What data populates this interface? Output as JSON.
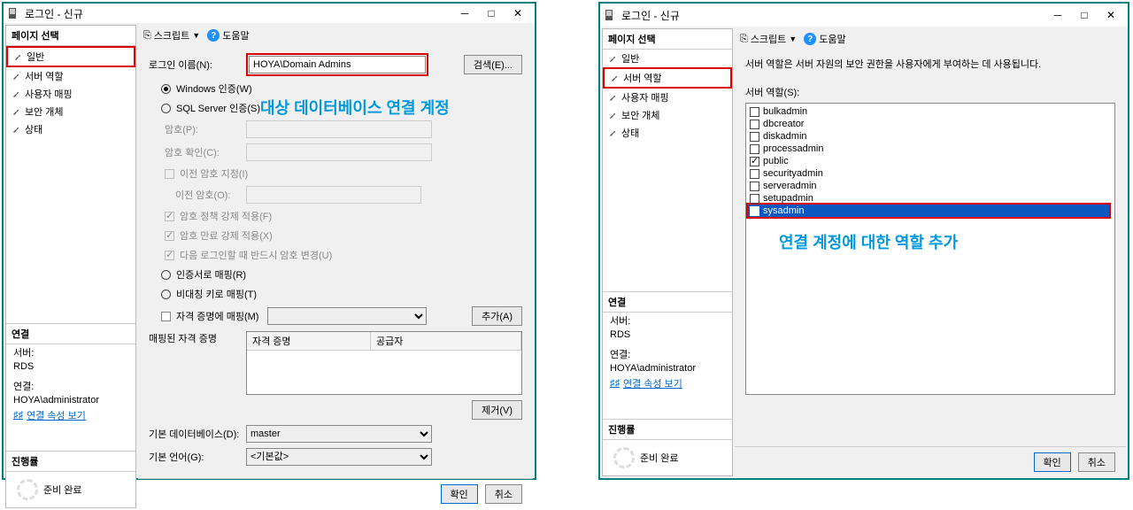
{
  "dlg1": {
    "title": "로그인 - 신규",
    "sidebar": {
      "head": "페이지 선택",
      "items": [
        {
          "label": "일반"
        },
        {
          "label": "서버 역할"
        },
        {
          "label": "사용자 매핑"
        },
        {
          "label": "보안 개체"
        },
        {
          "label": "상태"
        }
      ],
      "conn_head": "연결",
      "server_lbl": "서버:",
      "server_val": "RDS",
      "conn_lbl": "연결:",
      "conn_val": "HOYA\\administrator",
      "link": "연결 속성 보기",
      "prog_head": "진행률",
      "ready": "준비 완료"
    },
    "toolbar": {
      "script": "스크립트",
      "help": "도움말"
    },
    "form": {
      "login_lbl": "로그인 이름(N):",
      "login_val": "HOYA\\Domain Admins",
      "search_btn": "검색(E)...",
      "win_auth": "Windows 인증(W)",
      "sql_auth": "SQL Server 인증(S)",
      "pwd_lbl": "암호(P):",
      "pwdc_lbl": "암호 확인(C):",
      "oldpwd_spec": "이전 암호 지정(I)",
      "oldpwd_lbl": "이전 암호(O):",
      "pol1": "암호 정책 강제 적용(F)",
      "pol2": "암호 만료 강제 적용(X)",
      "pol3": "다음 로그인할 때 반드시 암호 변경(U)",
      "cert_map": "인증서로 매핑(R)",
      "asym_map": "비대칭 키로 매핑(T)",
      "cred_map": "자격 증명에 매핑(M)",
      "add_btn": "추가(A)",
      "mapped_lbl": "매핑된 자격 증명",
      "col1": "자격 증명",
      "col2": "공급자",
      "remove_btn": "제거(V)",
      "defdb_lbl": "기본 데이터베이스(D):",
      "defdb_val": "master",
      "lang_lbl": "기본 언어(G):",
      "lang_val": "<기본값>"
    },
    "footer": {
      "ok": "확인",
      "cancel": "취소"
    },
    "annot": "대상 데이터베이스 연결 계정"
  },
  "dlg2": {
    "title": "로그인 - 신규",
    "sidebar": {
      "head": "페이지 선택",
      "items": [
        {
          "label": "일반"
        },
        {
          "label": "서버 역할"
        },
        {
          "label": "사용자 매핑"
        },
        {
          "label": "보안 개체"
        },
        {
          "label": "상태"
        }
      ],
      "conn_head": "연결",
      "server_lbl": "서버:",
      "server_val": "RDS",
      "conn_lbl": "연결:",
      "conn_val": "HOYA\\administrator",
      "link": "연결 속성 보기",
      "prog_head": "진행률",
      "ready": "준비 완료"
    },
    "toolbar": {
      "script": "스크립트",
      "help": "도움말"
    },
    "content": {
      "desc": "서버 역할은 서버 자원의 보안 권한을 사용자에게 부여하는 데 사용됩니다.",
      "role_lbl": "서버 역할(S):",
      "roles": [
        {
          "name": "bulkadmin",
          "checked": false,
          "selected": false
        },
        {
          "name": "dbcreator",
          "checked": false,
          "selected": false
        },
        {
          "name": "diskadmin",
          "checked": false,
          "selected": false
        },
        {
          "name": "processadmin",
          "checked": false,
          "selected": false
        },
        {
          "name": "public",
          "checked": true,
          "selected": false
        },
        {
          "name": "securityadmin",
          "checked": false,
          "selected": false
        },
        {
          "name": "serveradmin",
          "checked": false,
          "selected": false
        },
        {
          "name": "setupadmin",
          "checked": false,
          "selected": false
        },
        {
          "name": "sysadmin",
          "checked": true,
          "selected": true
        }
      ]
    },
    "footer": {
      "ok": "확인",
      "cancel": "취소"
    },
    "annot": "연결 계정에 대한 역할 추가"
  }
}
